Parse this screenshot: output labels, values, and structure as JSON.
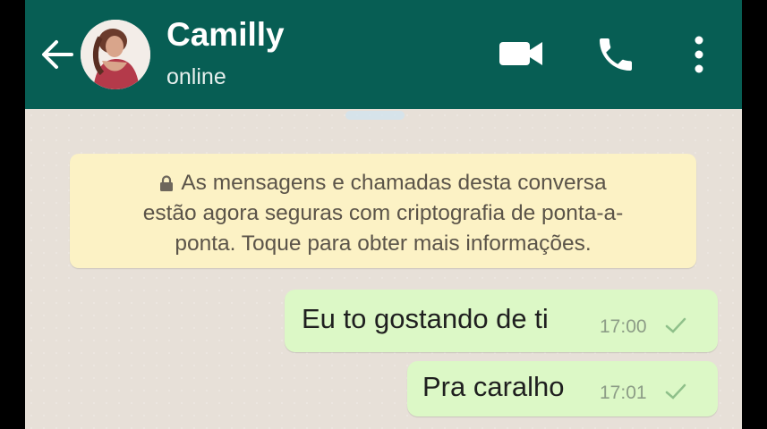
{
  "header": {
    "contact_name": "Camilly",
    "status": "online",
    "colors": {
      "bar": "#075e54",
      "icons": "#ffffff"
    },
    "icons": [
      "back-arrow-icon",
      "video-call-icon",
      "voice-call-icon",
      "more-options-icon"
    ]
  },
  "chat": {
    "encryption_notice": {
      "icon": "lock-icon",
      "lines": [
        "As mensagens e chamadas desta conversa",
        "estão agora seguras com criptografia de ponta-a-",
        "ponta. Toque para obter mais informações."
      ]
    },
    "messages": [
      {
        "text": "Eu to gostando de ti",
        "time": "17:00",
        "status_icon": "sent-check-icon"
      },
      {
        "text": "Pra caralho",
        "time": "17:01",
        "status_icon": "sent-check-icon"
      }
    ],
    "colors": {
      "outgoing_bubble": "#dcf8c6",
      "notice": "#fcf2c5"
    }
  }
}
